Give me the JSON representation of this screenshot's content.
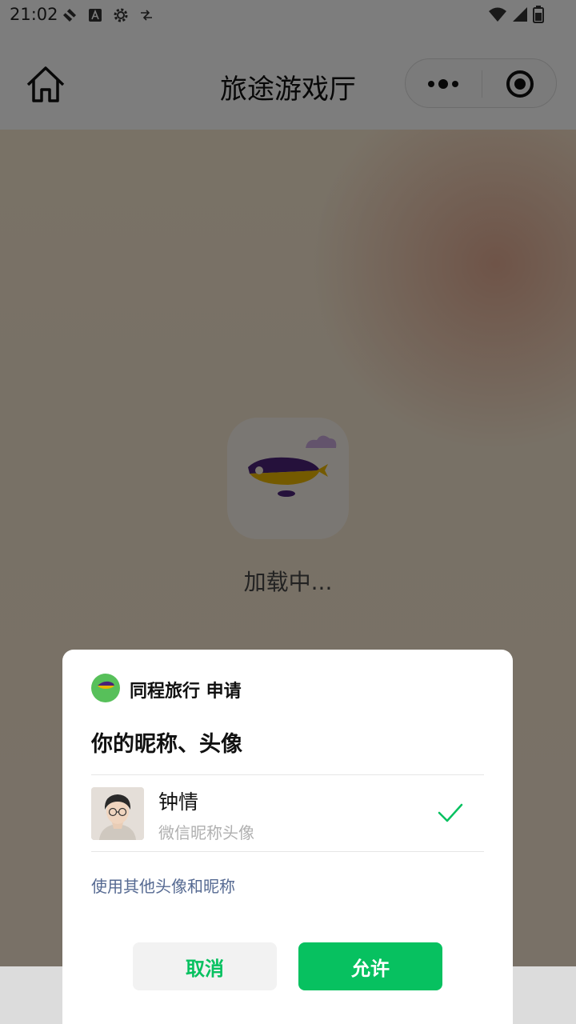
{
  "status_bar": {
    "time": "21:02",
    "icons": [
      "signal-off-icon",
      "font-a-icon",
      "gear-icon",
      "data-icon",
      "wifi-icon",
      "cell-signal-icon",
      "battery-icon"
    ]
  },
  "header": {
    "title": "旅途游戏厅",
    "home_icon": "home-icon",
    "more_icon": "more-dots-icon",
    "close_icon": "target-close-icon"
  },
  "loading": {
    "text": "加载中..."
  },
  "auth_sheet": {
    "app_name_request": "同程旅行 申请",
    "logo_text": "同程旅行",
    "title": "你的昵称、头像",
    "account": {
      "nickname": "钟情",
      "subtitle": "微信昵称头像",
      "selected": true
    },
    "other_link": "使用其他头像和昵称",
    "cancel_label": "取消",
    "allow_label": "允许"
  },
  "colors": {
    "accent_green": "#07c160",
    "link_blue": "#566a92",
    "airship_purple": "#4a2277",
    "airship_yellow": "#e8b500"
  },
  "nav_bar": {
    "back_icon": "back-triangle-icon",
    "home_icon": "home-circle-icon",
    "recent_icon": "recent-square-icon"
  }
}
